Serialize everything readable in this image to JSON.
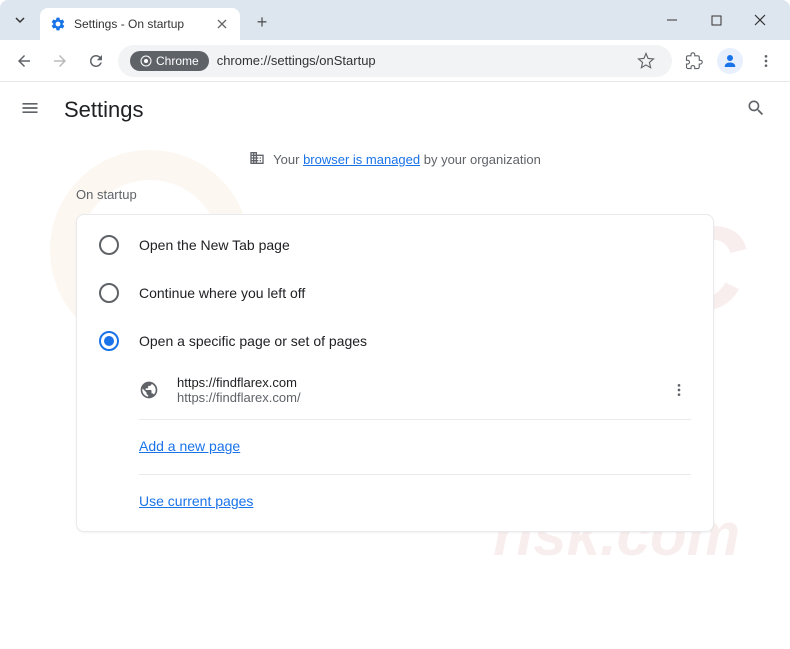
{
  "window": {
    "tab_title": "Settings - On startup"
  },
  "toolbar": {
    "chrome_chip": "Chrome",
    "url": "chrome://settings/onStartup"
  },
  "settings": {
    "title": "Settings",
    "managed_prefix": "Your ",
    "managed_link": "browser is managed",
    "managed_suffix": " by your organization",
    "section_label": "On startup",
    "options": {
      "new_tab": "Open the New Tab page",
      "continue": "Continue where you left off",
      "specific": "Open a specific page or set of pages"
    },
    "pages": [
      {
        "title": "https://findflarex.com",
        "url": "https://findflarex.com/"
      }
    ],
    "add_page": "Add a new page",
    "use_current": "Use current pages"
  }
}
